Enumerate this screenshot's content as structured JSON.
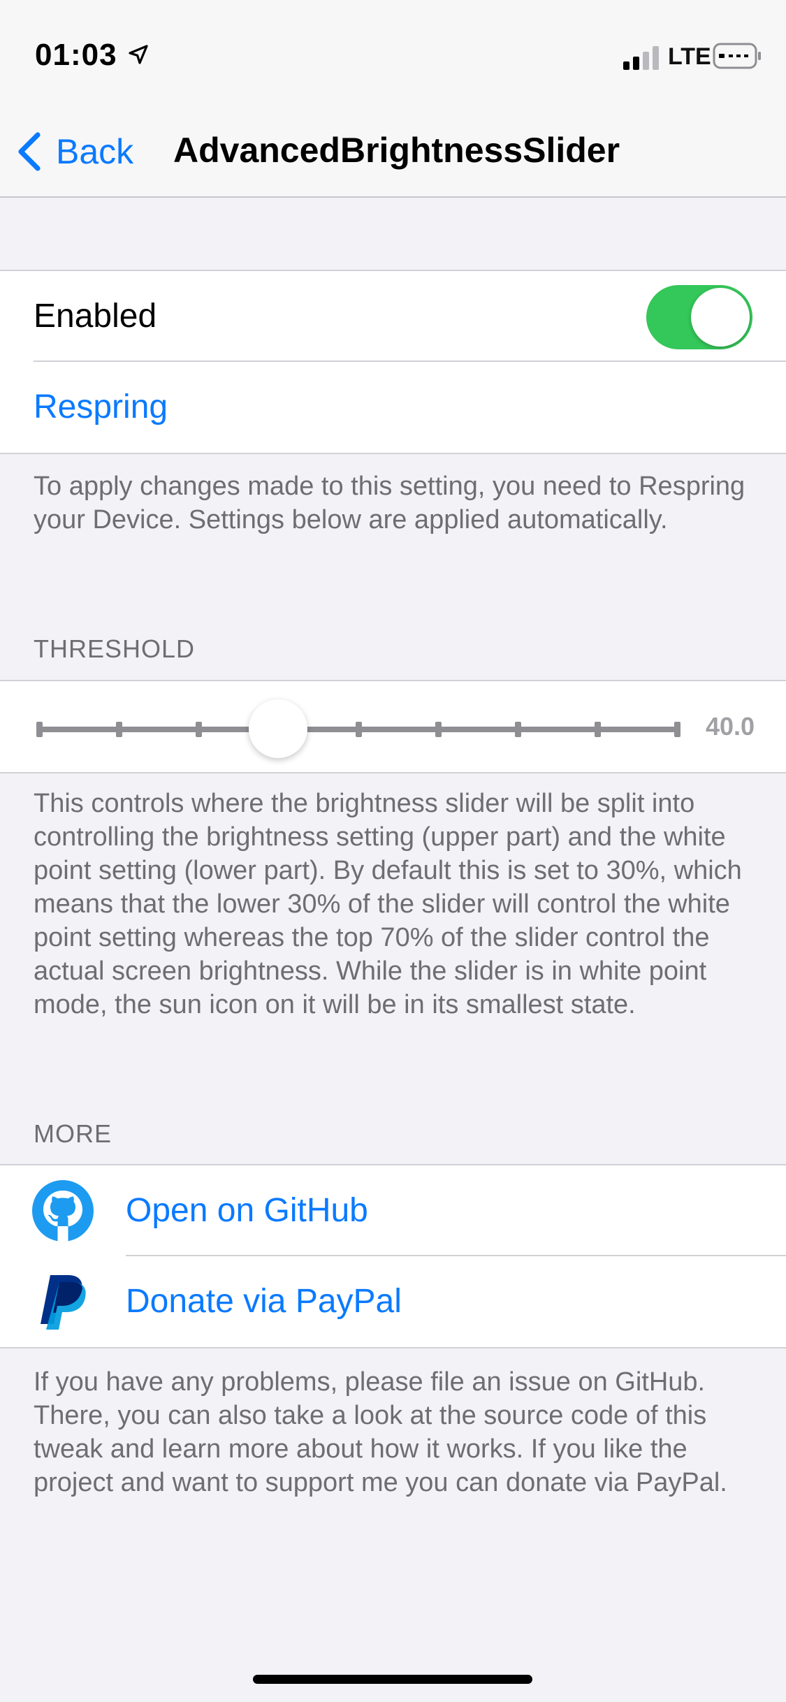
{
  "status_bar": {
    "time": "01:03",
    "network": "LTE"
  },
  "nav": {
    "back_label": "Back",
    "title": "AdvancedBrightnessSlider"
  },
  "general": {
    "enabled_label": "Enabled",
    "enabled": true,
    "respring_label": "Respring",
    "footer": "To apply changes made to this setting, you need to Respring your Device. Settings below are applied automatically."
  },
  "threshold": {
    "header": "THRESHOLD",
    "value_text": "40.0",
    "value": 40,
    "min": 10,
    "max": 90,
    "tick_count": 9,
    "footer": "This controls where the brightness slider will be split into controlling the brightness setting (upper part) and the white point setting (lower part). By default this is set to 30%, which means that the lower 30% of the slider will control the white point setting whereas the top 70% of the slider control the actual screen brightness. While the slider is in white point mode, the sun icon on it will be in its smallest state."
  },
  "more": {
    "header": "MORE",
    "github_label": "Open on GitHub",
    "paypal_label": "Donate via PayPal",
    "footer": "If you have any problems, please file an issue on GitHub. There, you can also take a look at the source code of this tweak and learn more about how it works. If you like the project and want to support me you can donate via PayPal."
  },
  "icons": [
    "location-arrow-icon",
    "signal-bars-icon",
    "battery-icon",
    "chevron-left-icon",
    "github-icon",
    "paypal-icon"
  ],
  "colors": {
    "accent": "#0a7aff",
    "toggle_on": "#34c759",
    "background": "#f2f2f7",
    "footer_text": "#6d6d72"
  }
}
